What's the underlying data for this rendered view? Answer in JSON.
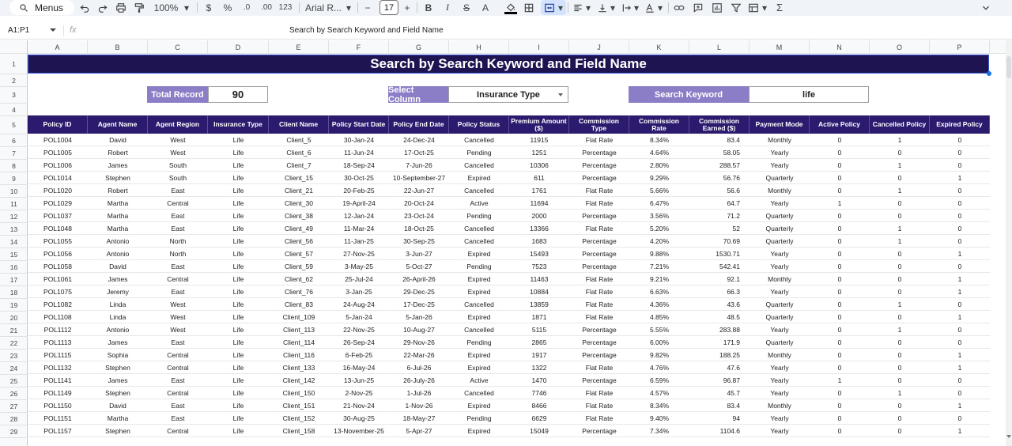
{
  "toolbar": {
    "menus_label": "Menus",
    "zoom": "100%",
    "currency": "$",
    "percent": "%",
    "dec_decrease": ".0",
    "dec_increase": ".00",
    "number_format": "123",
    "font_name": "Arial R...",
    "font_size": "17",
    "minus": "−",
    "plus": "+",
    "bold": "B",
    "italic": "I",
    "strike": "S",
    "text_color": "A",
    "sigma": "Σ"
  },
  "formula_bar": {
    "name_box": "A1:P1",
    "fx": "fx",
    "content": "Search by Search Keyword and Field Name"
  },
  "columns": [
    "A",
    "B",
    "C",
    "D",
    "E",
    "F",
    "G",
    "H",
    "I",
    "J",
    "K",
    "L",
    "M",
    "N",
    "O",
    "P"
  ],
  "rows": [
    "1",
    "2",
    "3",
    "4",
    "5",
    "6",
    "7",
    "8",
    "9",
    "10",
    "11",
    "12",
    "13",
    "14",
    "15",
    "16",
    "17",
    "18",
    "19",
    "20",
    "21",
    "22",
    "23",
    "24",
    "25",
    "26",
    "27",
    "28",
    "29"
  ],
  "sheet": {
    "title": "Search by Search Keyword and Field Name",
    "total_record_label": "Total Record",
    "total_record_value": "90",
    "select_column_label": "Select Column",
    "select_column_value": "Insurance Type",
    "search_keyword_label": "Search Keyword",
    "search_keyword_value": "life"
  },
  "table": {
    "headers": [
      "Policy ID",
      "Agent Name",
      "Agent Region",
      "Insurance Type",
      "Client Name",
      "Policy Start Date",
      "Policy End Date",
      "Policy Status",
      "Premium Amount ($)",
      "Commission Type",
      "Commission Rate",
      "Commission Earned ($)",
      "Payment Mode",
      "Active Policy",
      "Cancelled Policy",
      "Expired Policy"
    ],
    "rows": [
      [
        "POL1004",
        "David",
        "West",
        "Life",
        "Client_5",
        "30-Jan-24",
        "24-Dec-24",
        "Cancelled",
        "11915",
        "Flat Rate",
        "8.34%",
        "83.4",
        "Monthly",
        "0",
        "1",
        "0"
      ],
      [
        "POL1005",
        "Robert",
        "West",
        "Life",
        "Client_6",
        "11-Jun-24",
        "17-Oct-25",
        "Pending",
        "1251",
        "Percentage",
        "4.64%",
        "58.05",
        "Yearly",
        "0",
        "0",
        "0"
      ],
      [
        "POL1006",
        "James",
        "South",
        "Life",
        "Client_7",
        "18-Sep-24",
        "7-Jun-26",
        "Cancelled",
        "10306",
        "Percentage",
        "2.80%",
        "288.57",
        "Yearly",
        "0",
        "1",
        "0"
      ],
      [
        "POL1014",
        "Stephen",
        "South",
        "Life",
        "Client_15",
        "30-Oct-25",
        "10-September-27",
        "Expired",
        "611",
        "Percentage",
        "9.29%",
        "56.76",
        "Quarterly",
        "0",
        "0",
        "1"
      ],
      [
        "POL1020",
        "Robert",
        "East",
        "Life",
        "Client_21",
        "20-Feb-25",
        "22-Jun-27",
        "Cancelled",
        "1761",
        "Flat Rate",
        "5.66%",
        "56.6",
        "Monthly",
        "0",
        "1",
        "0"
      ],
      [
        "POL1029",
        "Martha",
        "Central",
        "Life",
        "Client_30",
        "19-April-24",
        "20-Oct-24",
        "Active",
        "11694",
        "Flat Rate",
        "6.47%",
        "64.7",
        "Yearly",
        "1",
        "0",
        "0"
      ],
      [
        "POL1037",
        "Martha",
        "East",
        "Life",
        "Client_38",
        "12-Jan-24",
        "23-Oct-24",
        "Pending",
        "2000",
        "Percentage",
        "3.56%",
        "71.2",
        "Quarterly",
        "0",
        "0",
        "0"
      ],
      [
        "POL1048",
        "Martha",
        "East",
        "Life",
        "Client_49",
        "11-Mar-24",
        "18-Oct-25",
        "Cancelled",
        "13366",
        "Flat Rate",
        "5.20%",
        "52",
        "Quarterly",
        "0",
        "1",
        "0"
      ],
      [
        "POL1055",
        "Antonio",
        "North",
        "Life",
        "Client_56",
        "11-Jan-25",
        "30-Sep-25",
        "Cancelled",
        "1683",
        "Percentage",
        "4.20%",
        "70.69",
        "Quarterly",
        "0",
        "1",
        "0"
      ],
      [
        "POL1056",
        "Antonio",
        "North",
        "Life",
        "Client_57",
        "27-Nov-25",
        "3-Jun-27",
        "Expired",
        "15493",
        "Percentage",
        "9.88%",
        "1530.71",
        "Yearly",
        "0",
        "0",
        "1"
      ],
      [
        "POL1058",
        "David",
        "East",
        "Life",
        "Client_59",
        "3-May-25",
        "5-Oct-27",
        "Pending",
        "7523",
        "Percentage",
        "7.21%",
        "542.41",
        "Yearly",
        "0",
        "0",
        "0"
      ],
      [
        "POL1061",
        "James",
        "Central",
        "Life",
        "Client_62",
        "25-Jul-24",
        "26-April-26",
        "Expired",
        "11463",
        "Flat Rate",
        "9.21%",
        "92.1",
        "Monthly",
        "0",
        "0",
        "1"
      ],
      [
        "POL1075",
        "Jeremy",
        "East",
        "Life",
        "Client_76",
        "3-Jan-25",
        "29-Dec-25",
        "Expired",
        "10884",
        "Flat Rate",
        "6.63%",
        "66.3",
        "Yearly",
        "0",
        "0",
        "1"
      ],
      [
        "POL1082",
        "Linda",
        "West",
        "Life",
        "Client_83",
        "24-Aug-24",
        "17-Dec-25",
        "Cancelled",
        "13859",
        "Flat Rate",
        "4.36%",
        "43.6",
        "Quarterly",
        "0",
        "1",
        "0"
      ],
      [
        "POL1108",
        "Linda",
        "West",
        "Life",
        "Client_109",
        "5-Jan-24",
        "5-Jan-26",
        "Expired",
        "1871",
        "Flat Rate",
        "4.85%",
        "48.5",
        "Quarterly",
        "0",
        "0",
        "1"
      ],
      [
        "POL1112",
        "Antonio",
        "West",
        "Life",
        "Client_113",
        "22-Nov-25",
        "10-Aug-27",
        "Cancelled",
        "5115",
        "Percentage",
        "5.55%",
        "283.88",
        "Yearly",
        "0",
        "1",
        "0"
      ],
      [
        "POL1113",
        "James",
        "East",
        "Life",
        "Client_114",
        "26-Sep-24",
        "29-Nov-26",
        "Pending",
        "2865",
        "Percentage",
        "6.00%",
        "171.9",
        "Quarterly",
        "0",
        "0",
        "0"
      ],
      [
        "POL1115",
        "Sophia",
        "Central",
        "Life",
        "Client_116",
        "6-Feb-25",
        "22-Mar-26",
        "Expired",
        "1917",
        "Percentage",
        "9.82%",
        "188.25",
        "Monthly",
        "0",
        "0",
        "1"
      ],
      [
        "POL1132",
        "Stephen",
        "Central",
        "Life",
        "Client_133",
        "16-May-24",
        "6-Jul-26",
        "Expired",
        "1322",
        "Flat Rate",
        "4.76%",
        "47.6",
        "Yearly",
        "0",
        "0",
        "1"
      ],
      [
        "POL1141",
        "James",
        "East",
        "Life",
        "Client_142",
        "13-Jun-25",
        "26-July-26",
        "Active",
        "1470",
        "Percentage",
        "6.59%",
        "96.87",
        "Yearly",
        "1",
        "0",
        "0"
      ],
      [
        "POL1149",
        "Stephen",
        "Central",
        "Life",
        "Client_150",
        "2-Nov-25",
        "1-Jul-26",
        "Cancelled",
        "7746",
        "Flat Rate",
        "4.57%",
        "45.7",
        "Yearly",
        "0",
        "1",
        "0"
      ],
      [
        "POL1150",
        "David",
        "East",
        "Life",
        "Client_151",
        "21-Nov-24",
        "1-Nov-26",
        "Expired",
        "8466",
        "Flat Rate",
        "8.34%",
        "83.4",
        "Monthly",
        "0",
        "0",
        "1"
      ],
      [
        "POL1151",
        "Martha",
        "East",
        "Life",
        "Client_152",
        "30-Aug-25",
        "18-May-27",
        "Pending",
        "6629",
        "Flat Rate",
        "9.40%",
        "94",
        "Yearly",
        "0",
        "0",
        "0"
      ],
      [
        "POL1157",
        "Stephen",
        "Central",
        "Life",
        "Client_158",
        "13-November-25",
        "5-Apr-27",
        "Expired",
        "15049",
        "Percentage",
        "7.34%",
        "1104.6",
        "Yearly",
        "0",
        "0",
        "1"
      ]
    ]
  }
}
